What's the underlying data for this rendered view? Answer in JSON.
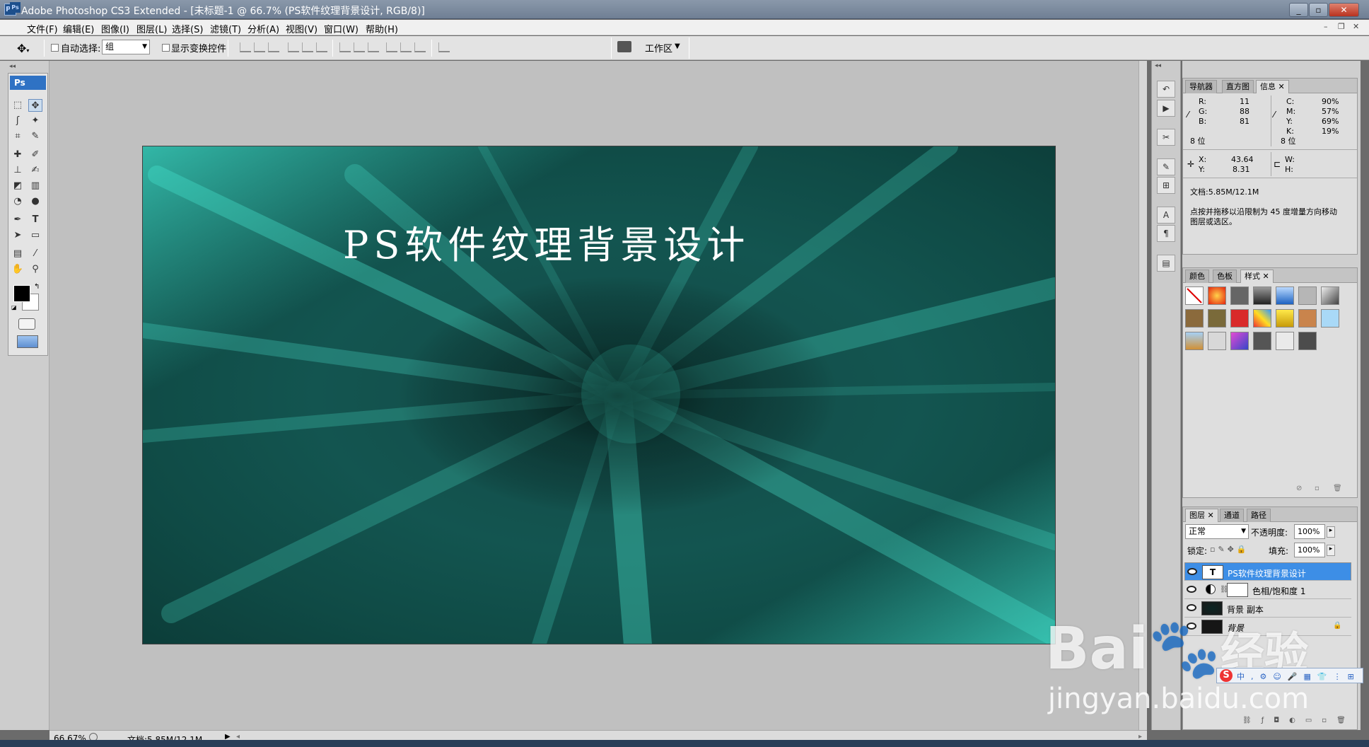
{
  "window": {
    "title": "Adobe Photoshop CS3 Extended - [未标题-1 @ 66.7% (PS软件纹理背景设计, RGB/8)]",
    "app_icon": "Ps"
  },
  "menu": [
    "文件(F)",
    "编辑(E)",
    "图像(I)",
    "图层(L)",
    "选择(S)",
    "滤镜(T)",
    "分析(A)",
    "视图(V)",
    "窗口(W)",
    "帮助(H)"
  ],
  "options": {
    "auto_select_label": "自动选择:",
    "auto_select_value": "组",
    "show_transform_label": "显示变换控件",
    "workspace_label": "工作区"
  },
  "toolbox": {
    "header": "Ps"
  },
  "canvas": {
    "text": "PS软件纹理背景设计"
  },
  "status": {
    "zoom": "66.67%",
    "doc": "文档:5.85M/12.1M"
  },
  "info_panel": {
    "tabs": [
      "导航器",
      "直方图",
      "信息"
    ],
    "rgb": {
      "r_label": "R:",
      "r": "11",
      "g_label": "G:",
      "g": "88",
      "b_label": "B:",
      "b": "81",
      "bit": "8 位"
    },
    "cmyk": {
      "c_label": "C:",
      "c": "90%",
      "m_label": "M:",
      "m": "57%",
      "y_label": "Y:",
      "y": "69%",
      "k_label": "K:",
      "k": "19%",
      "bit": "8 位"
    },
    "xy": {
      "x_label": "X:",
      "x": "43.64",
      "y_label": "Y:",
      "y": "8.31"
    },
    "wh": {
      "w_label": "W:",
      "h_label": "H:"
    },
    "doc": "文档:5.85M/12.1M",
    "hint_line1": "点按并拖移以沿限制为 45 度增量方向移动",
    "hint_line2": "图层或选区。"
  },
  "styles_panel": {
    "tabs": [
      "颜色",
      "色板",
      "样式"
    ]
  },
  "layers_panel": {
    "tabs": [
      "图层",
      "通道",
      "路径"
    ],
    "blend_mode": "正常",
    "opacity_label": "不透明度:",
    "opacity": "100%",
    "lock_label": "锁定:",
    "fill_label": "填充:",
    "fill": "100%",
    "layers": [
      {
        "name": "PS软件纹理背景设计",
        "thumb": "T"
      },
      {
        "name": "色相/饱和度 1"
      },
      {
        "name": "背景 副本"
      },
      {
        "name": "背景"
      }
    ]
  },
  "watermark": {
    "brand": "Bai",
    "brand_cn": "经验",
    "url": "jingyan.baidu.com"
  }
}
